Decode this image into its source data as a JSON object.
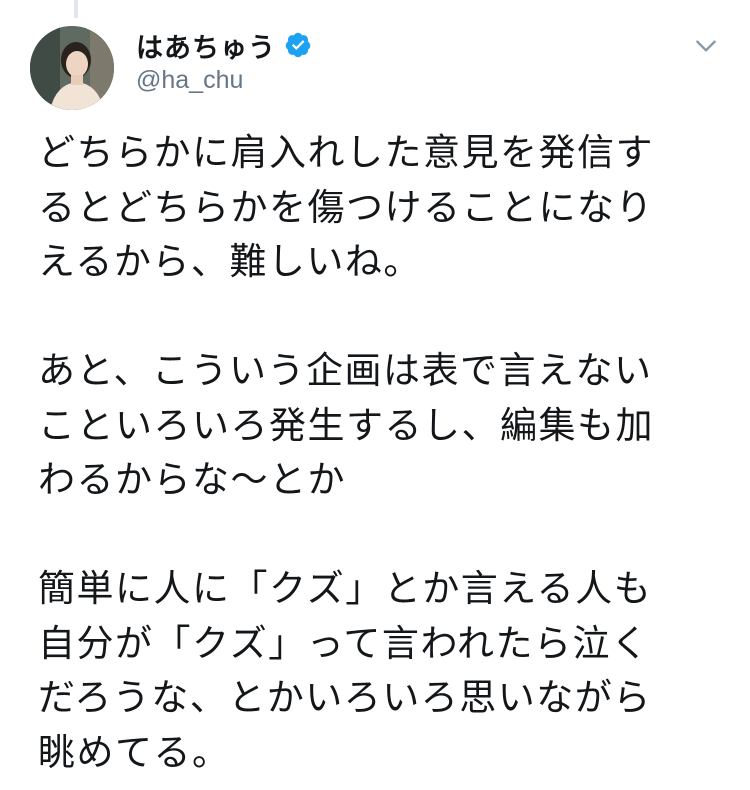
{
  "user": {
    "display_name": "はあちゅう",
    "handle": "@ha_chu",
    "verified": true
  },
  "icons": {
    "verified": "verified-badge-icon",
    "menu": "chevron-down-icon"
  },
  "colors": {
    "verified_blue": "#1da1f2",
    "handle_gray": "#657786",
    "text": "#14171a"
  },
  "tweet": {
    "paragraphs": [
      {
        "lines": [
          "どちらかに肩入れした意見を発信す",
          "るとどちらかを傷つけることになり",
          "えるから、難しいね。"
        ]
      },
      {
        "lines": [
          "あと、こういう企画は表で言えない",
          "こといろいろ発生するし、編集も加",
          "わるからな〜とか"
        ]
      },
      {
        "lines": [
          "簡単に人に「クズ」とか言える人も",
          "自分が「クズ」って言われたら泣く",
          "だろうな、とかいろいろ思いながら",
          "眺めてる。"
        ]
      }
    ]
  }
}
